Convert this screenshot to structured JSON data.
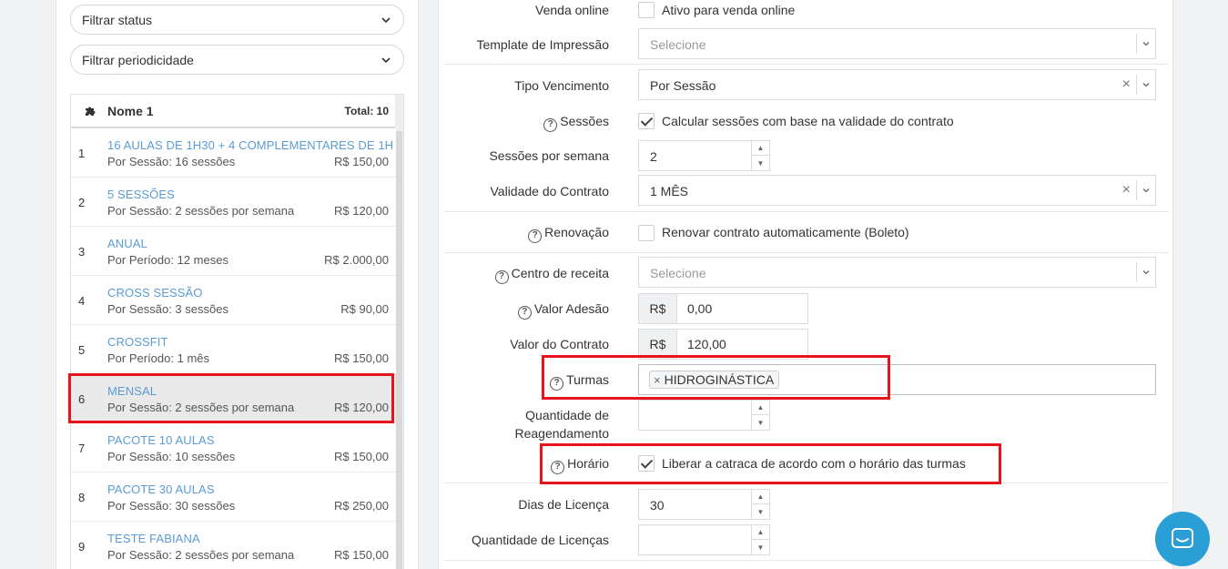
{
  "filters": {
    "status": "Filtrar status",
    "periodicity": "Filtrar periodicidade"
  },
  "list": {
    "header_name": "Nome 1",
    "header_total": "Total: 10",
    "rows": [
      {
        "idx": "1",
        "title": "16 AULAS DE 1H30 + 4 COMPLEMENTARES DE 1H",
        "sub": "Por Sessão: 16 sessões",
        "price": "R$ 150,00"
      },
      {
        "idx": "2",
        "title": "5 SESSÕES",
        "sub": "Por Sessão: 2 sessões por semana",
        "price": "R$ 120,00"
      },
      {
        "idx": "3",
        "title": "ANUAL",
        "sub": "Por Período: 12 meses",
        "price": "R$ 2.000,00"
      },
      {
        "idx": "4",
        "title": "CROSS SESSÃO",
        "sub": "Por Sessão: 3 sessões",
        "price": "R$ 90,00"
      },
      {
        "idx": "5",
        "title": "CROSSFIT",
        "sub": "Por Período: 1 mês",
        "price": "R$ 150,00"
      },
      {
        "idx": "6",
        "title": "MENSAL",
        "sub": "Por Sessão: 2 sessões por semana",
        "price": "R$ 120,00"
      },
      {
        "idx": "7",
        "title": "PACOTE 10 AULAS",
        "sub": "Por Sessão: 10 sessões",
        "price": "R$ 150,00"
      },
      {
        "idx": "8",
        "title": "PACOTE 30 AULAS",
        "sub": "Por Sessão: 30 sessões",
        "price": "R$ 250,00"
      },
      {
        "idx": "9",
        "title": "TESTE FABIANA",
        "sub": "Por Sessão: 2 sessões por semana",
        "price": "R$ 150,00"
      }
    ]
  },
  "form": {
    "venda_online": {
      "label": "Venda online",
      "checkbox_text": "Ativo para venda online"
    },
    "template": {
      "label": "Template de Impressão",
      "placeholder": "Selecione"
    },
    "tipo_vencimento": {
      "label": "Tipo Vencimento",
      "value": "Por Sessão"
    },
    "sessoes": {
      "label": "Sessões",
      "checkbox_text": "Calcular sessões com base na validade do contrato"
    },
    "sessoes_semana": {
      "label": "Sessões por semana",
      "value": "2"
    },
    "validade": {
      "label": "Validade do Contrato",
      "value": "1 MÊS"
    },
    "renovacao": {
      "label": "Renovação",
      "checkbox_text": "Renovar contrato automaticamente (Boleto)"
    },
    "centro_receita": {
      "label": "Centro de receita",
      "placeholder": "Selecione"
    },
    "valor_adesao": {
      "label": "Valor Adesão",
      "prefix": "R$",
      "value": "0,00"
    },
    "valor_contrato": {
      "label": "Valor do Contrato",
      "prefix": "R$",
      "value": "120,00"
    },
    "turmas": {
      "label": "Turmas",
      "tag": "HIDROGINÁSTICA"
    },
    "reagendamento": {
      "label_line1": "Quantidade de",
      "label_line2": "Reagendamento",
      "value": ""
    },
    "horario": {
      "label": "Horário",
      "checkbox_text": "Liberar a catraca de acordo com o horário das turmas"
    },
    "dias_licenca": {
      "label": "Dias de Licença",
      "value": "30"
    },
    "qtd_licencas": {
      "label": "Quantidade de Licenças",
      "value": ""
    }
  },
  "colors": {
    "highlight": "#e8141b",
    "link": "#5a9bd5",
    "chat": "#2a9fd6"
  }
}
